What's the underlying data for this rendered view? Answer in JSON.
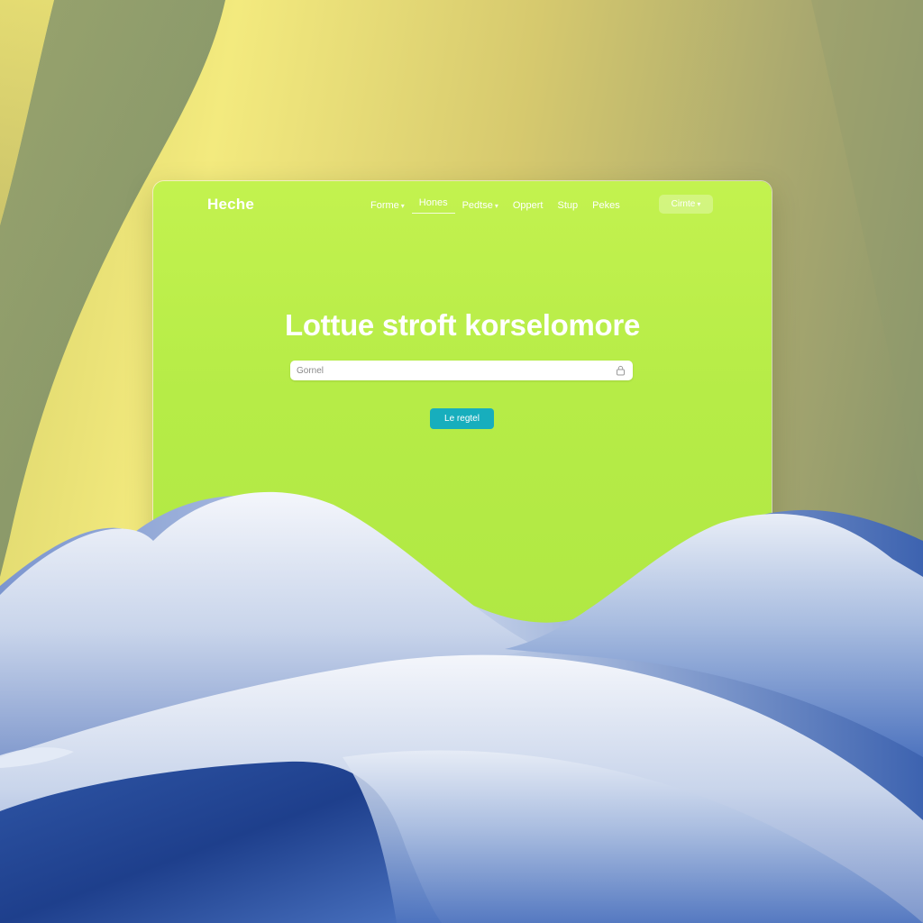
{
  "header": {
    "brand": "Heche",
    "nav": [
      {
        "label": "Forme",
        "dropdown": true,
        "active": false
      },
      {
        "label": "Hones",
        "dropdown": false,
        "active": true
      },
      {
        "label": "Pedtse",
        "dropdown": true,
        "active": false
      },
      {
        "label": "Oppert",
        "dropdown": false,
        "active": false
      },
      {
        "label": "Stup",
        "dropdown": false,
        "active": false
      },
      {
        "label": "Pekes",
        "dropdown": false,
        "active": false
      }
    ],
    "cta": {
      "label": "Cirnte",
      "dropdown": true
    }
  },
  "hero": {
    "title": "Lottue stroft korselomore",
    "search": {
      "placeholder": "Gornel",
      "icon": "lock-icon"
    },
    "button_label": "Le regtel"
  },
  "colors": {
    "window_bg": "#b6ec47",
    "button_bg": "#17aebd",
    "text": "#ffffff"
  }
}
